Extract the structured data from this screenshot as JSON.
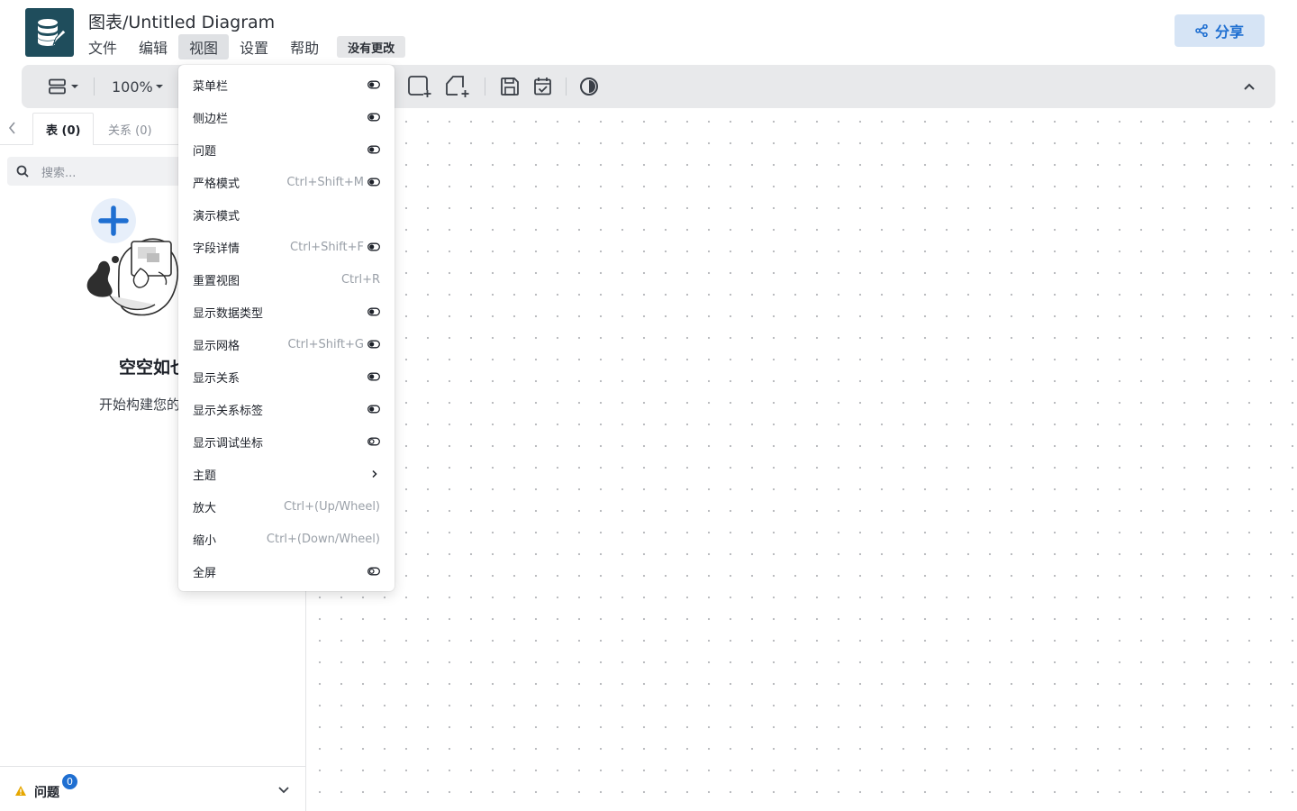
{
  "header": {
    "title": "图表/Untitled Diagram",
    "menu": [
      "文件",
      "编辑",
      "视图",
      "设置",
      "帮助"
    ],
    "active_menu": "视图",
    "status": "没有更改",
    "share_label": "分享"
  },
  "toolbar": {
    "zoom": "100%"
  },
  "sidebar": {
    "tabs": [
      "表 (0)",
      "关系 (0)"
    ],
    "search_placeholder": "搜索...",
    "empty_title": "空空如也",
    "empty_subtitle": "开始构建您的图表",
    "issues_label": "问题",
    "issues_count": "0"
  },
  "view_menu": {
    "items": [
      {
        "label": "菜单栏",
        "shortcut": "",
        "toggle": "on"
      },
      {
        "label": "侧边栏",
        "shortcut": "",
        "toggle": "on"
      },
      {
        "label": "问题",
        "shortcut": "",
        "toggle": "on"
      },
      {
        "label": "严格模式",
        "shortcut": "Ctrl+Shift+M",
        "toggle": "on"
      },
      {
        "label": "演示模式",
        "shortcut": "",
        "toggle": "none"
      },
      {
        "label": "字段详情",
        "shortcut": "Ctrl+Shift+F",
        "toggle": "on"
      },
      {
        "label": "重置视图",
        "shortcut": "Ctrl+R",
        "toggle": "none"
      },
      {
        "label": "显示数据类型",
        "shortcut": "",
        "toggle": "on"
      },
      {
        "label": "显示网格",
        "shortcut": "Ctrl+Shift+G",
        "toggle": "on"
      },
      {
        "label": "显示关系",
        "shortcut": "",
        "toggle": "on"
      },
      {
        "label": "显示关系标签",
        "shortcut": "",
        "toggle": "on"
      },
      {
        "label": "显示调试坐标",
        "shortcut": "",
        "toggle": "off"
      },
      {
        "label": "主题",
        "shortcut": "",
        "toggle": "submenu"
      },
      {
        "label": "放大",
        "shortcut": "Ctrl+(Up/Wheel)",
        "toggle": "none"
      },
      {
        "label": "缩小",
        "shortcut": "Ctrl+(Down/Wheel)",
        "toggle": "none"
      },
      {
        "label": "全屏",
        "shortcut": "",
        "toggle": "off"
      }
    ]
  },
  "colors": {
    "accent": "#1f6fd1",
    "logo_bg": "#1f4d5c",
    "warning": "#e6a700"
  }
}
